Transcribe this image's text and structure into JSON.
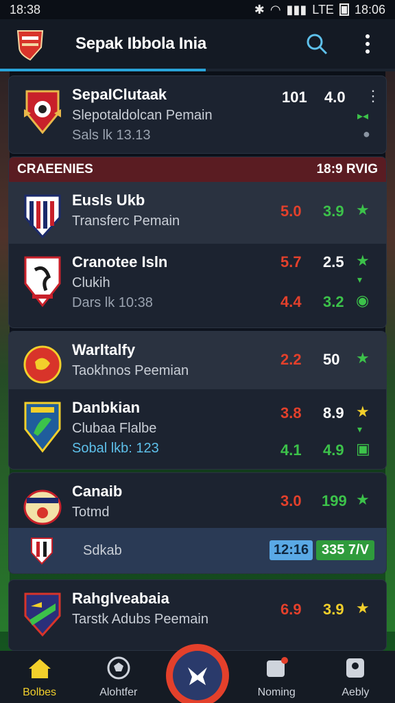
{
  "status": {
    "time": "18:38",
    "right_time": "18:06",
    "indicators": "LTE"
  },
  "app": {
    "title": "Sepak Ibbola Inia",
    "progress": 0.52
  },
  "top_card": {
    "name": "SepaIClutaak",
    "sub": "Slepotaldolcan Pemain",
    "time": "Sals lk 13.13",
    "val1": "101",
    "val2": "4.0"
  },
  "section": {
    "title": "CRAEENIES",
    "right": "18:9 RVIG",
    "rows": [
      {
        "name": "Eusls Ukb",
        "sub": "Transferc Pemain",
        "v1": "5.0",
        "v2": "3.9"
      },
      {
        "name": "Cranotee Isln",
        "sub": "Clukih",
        "time": "Dars lk 10:38",
        "v1": "5.7",
        "v2": "2.5",
        "v3": "4.4",
        "v4": "3.2"
      }
    ]
  },
  "card3": {
    "rows": [
      {
        "name": "Warltalfy",
        "sub": "Taokhnos Peemian",
        "v1": "2.2",
        "v2": "50"
      },
      {
        "name": "Danbkian",
        "sub": "Clubaa Flalbe",
        "time": "Sobal lkb: 123",
        "v1": "3.8",
        "v2": "8.9",
        "v3": "4.1",
        "v4": "4.9"
      }
    ]
  },
  "card4": {
    "row": {
      "name": "Canaib",
      "sub": "Totmd",
      "v1": "3.0",
      "v2": "199"
    },
    "footer": {
      "name": "Sdkab",
      "badge1": "12:16",
      "badge2": "335 7/V"
    }
  },
  "card5": {
    "name": "Rahglveabaia",
    "sub": "Tarstk Adubs Peemain",
    "v1": "6.9",
    "v2": "3.9"
  },
  "nav": [
    {
      "label": "Bolbes",
      "icon": "home-icon"
    },
    {
      "label": "Alohtfer",
      "icon": "ball-icon"
    },
    {
      "label": "Noming",
      "icon": "notification-icon"
    },
    {
      "label": "Aebly",
      "icon": "profile-icon"
    }
  ],
  "colors": {
    "accent": "#29a3d8",
    "red": "#e3402b",
    "green": "#3cc24a",
    "yellow": "#f2cf2b",
    "section": "#5a1c22"
  }
}
